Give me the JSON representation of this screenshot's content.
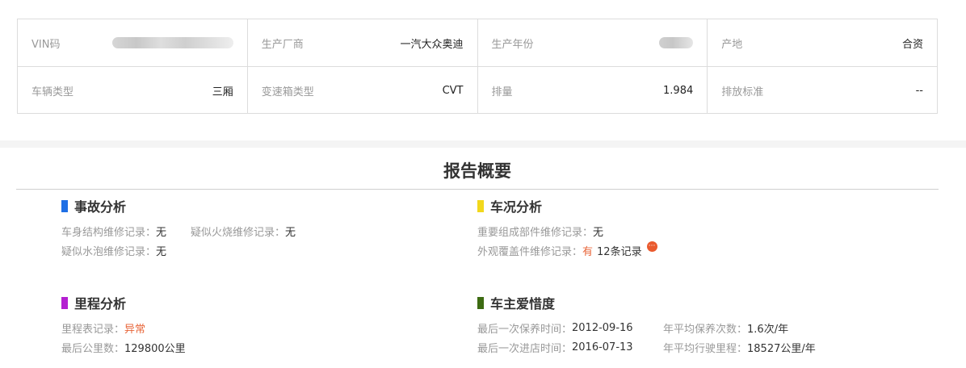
{
  "vehicle_info": {
    "row1": [
      {
        "label": "VIN码",
        "value": ""
      },
      {
        "label": "生产厂商",
        "value": "一汽大众奥迪"
      },
      {
        "label": "生产年份",
        "value": ""
      },
      {
        "label": "产地",
        "value": "合资"
      }
    ],
    "row2": [
      {
        "label": "车辆类型",
        "value": "三厢"
      },
      {
        "label": "变速箱类型",
        "value": "CVT"
      },
      {
        "label": "排量",
        "value": "1.984"
      },
      {
        "label": "排放标准",
        "value": "--"
      }
    ]
  },
  "report": {
    "title": "报告概要",
    "accident": {
      "title": "事故分析",
      "color": "#1f6fe5",
      "items": [
        {
          "label": "车身结构维修记录：",
          "value": "无"
        },
        {
          "label": "疑似火烧维修记录：",
          "value": "无"
        },
        {
          "label": "疑似水泡维修记录：",
          "value": "无"
        }
      ]
    },
    "condition": {
      "title": "车况分析",
      "color": "#f2d81c",
      "items": [
        {
          "label": "重要组成部件维修记录：",
          "value": "无"
        },
        {
          "label": "外观覆盖件维修记录：",
          "value": "有",
          "extra": "12条记录",
          "more_icon": "···"
        }
      ]
    },
    "mileage": {
      "title": "里程分析",
      "color": "#b41fd1",
      "items": [
        {
          "label": "里程表记录：",
          "value": "异常"
        },
        {
          "label": "最后公里数：",
          "value": "129800公里"
        }
      ]
    },
    "care": {
      "title": "车主爱惜度",
      "color": "#3d6b12",
      "items": [
        {
          "label": "最后一次保养时间：",
          "value": "2012-09-16"
        },
        {
          "label": "年平均保养次数：",
          "value": "1.6次/年"
        },
        {
          "label": "最后一次进店时间：",
          "value": "2016-07-13"
        },
        {
          "label": "年平均行驶里程：",
          "value": "18527公里/年"
        }
      ]
    }
  }
}
